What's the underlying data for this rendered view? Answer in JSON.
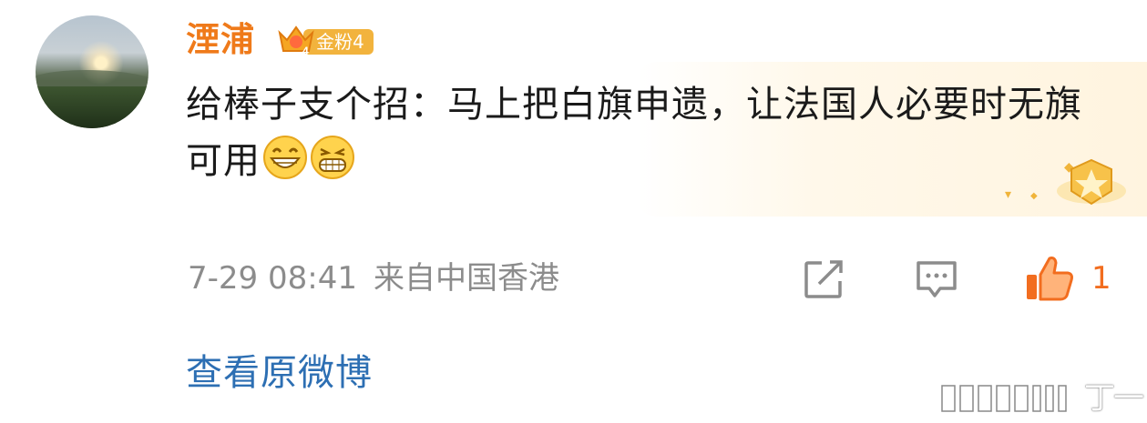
{
  "comment": {
    "username": "湮浦",
    "badge_level": "4",
    "badge_label": "金粉4",
    "text": "给棒子支个招：马上把白旗申遗，让法国人必要时无旗可用",
    "emojis": [
      "laugh-emoji",
      "grin-emoji"
    ]
  },
  "meta": {
    "time": "7-29 08:41",
    "location": "来自中国香港"
  },
  "actions": {
    "share_icon": "share-icon",
    "reply_icon": "comment-icon",
    "like_icon": "thumbs-up-icon",
    "like_count": "1"
  },
  "footer": {
    "view_original": "查看原微博"
  },
  "watermark": {
    "text": "丁一"
  },
  "colors": {
    "username": "#ef7a1a",
    "like": "#f26d1f",
    "link": "#2d6fb3",
    "meta": "#8c8c8c",
    "badge": "#f2b33d"
  }
}
